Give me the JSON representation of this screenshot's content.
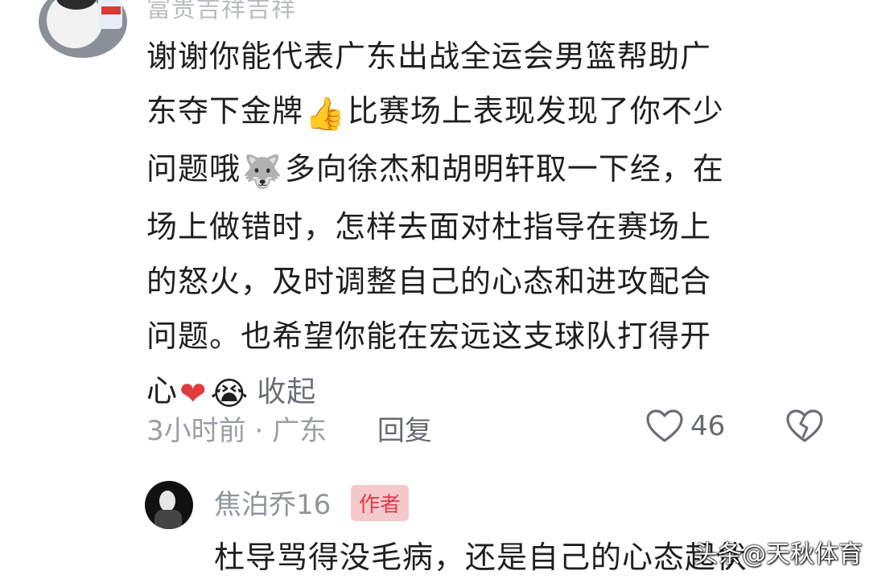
{
  "comment": {
    "username": "富贵吉祥吉祥",
    "lines": [
      "谢谢你能代表广东出战全运会男篮帮助广",
      "东夺下金牌",
      "比赛场上表现发现了你不少",
      "问题哦",
      "多向徐杰和胡明轩取一下经，在",
      "场上做错时，怎样去面对杜指导在赛场上",
      "的怒火，及时调整自己的心态和进攻配合",
      "问题。也希望你能在宏远这支球队打得开",
      "心"
    ],
    "emojis": {
      "thumbs_up": "👍",
      "husky": "🐺",
      "heart": "❤",
      "crying": "😭"
    },
    "collapse_label": "收起",
    "time": "3小时前",
    "separator": "·",
    "location": "广东",
    "reply_label": "回复",
    "like_count": "46"
  },
  "reply": {
    "author": "焦泊乔16",
    "badge": "作者",
    "text": "杜导骂得没毛病，还是自己的心态起伏"
  },
  "watermark": "头条@天秋体育",
  "colors": {
    "text": "#1f1f1f",
    "meta": "#9a9ea4",
    "badge_bg": "#f4c9cc",
    "badge_text": "#e33a4a"
  }
}
